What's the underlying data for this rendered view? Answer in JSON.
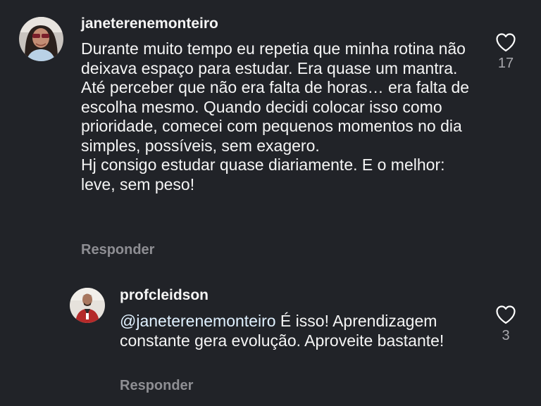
{
  "comments": [
    {
      "username": "janeterenemonteiro",
      "avatar_icon": "user-avatar-photo",
      "lines": [
        "Durante muito tempo eu repetia que minha rotina não deixava espaço para estudar. Era quase um mantra.",
        "Até perceber que não era falta de horas… era falta de escolha mesmo. Quando decidi colocar isso como prioridade, comecei com pequenos momentos no dia  simples, possíveis, sem exagero.",
        "Hj consigo estudar quase diariamente. E o melhor: leve, sem peso!"
      ],
      "reply_label": "Responder",
      "like_count": "17",
      "like_icon": "heart-outline-icon"
    },
    {
      "username": "profcleidson",
      "avatar_icon": "user-avatar-photo",
      "mention": "@janeterenemonteiro",
      "text": " É isso! Aprendizagem constante gera evolução. Aproveite bastante!",
      "reply_label": "Responder",
      "like_count": "3",
      "like_icon": "heart-outline-icon"
    }
  ],
  "colors": {
    "background": "#212328",
    "text": "#f5f5f5",
    "secondary": "#8e8e93"
  }
}
